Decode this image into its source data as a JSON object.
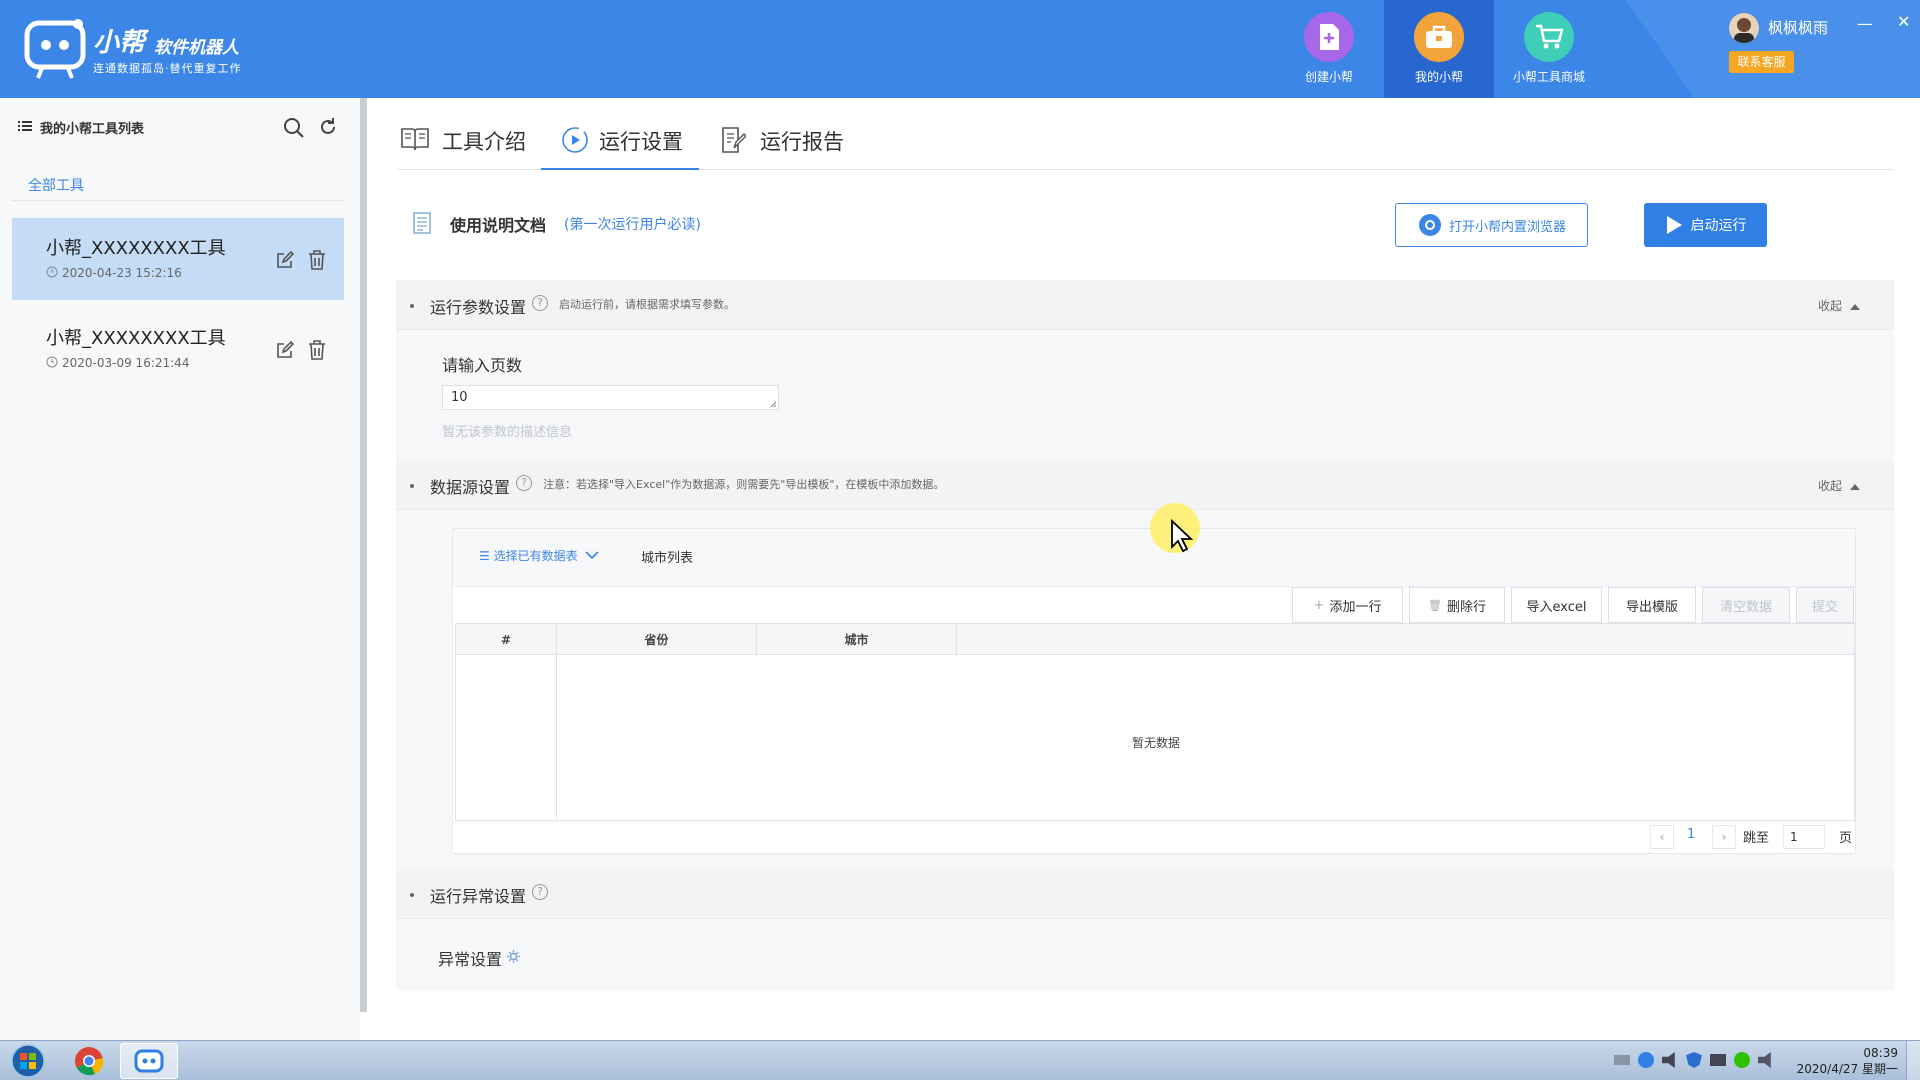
{
  "app": {
    "title": "小帮",
    "title_sub": "软件机器人",
    "slogan": "连通数据孤岛·替代重复工作"
  },
  "nav": [
    {
      "label": "创建小帮",
      "icon": "create-doc-icon",
      "color": "#a668e8"
    },
    {
      "label": "我的小帮",
      "icon": "toolbox-icon",
      "color": "#f2a33a"
    },
    {
      "label": "小帮工具商城",
      "icon": "cart-icon",
      "color": "#3fcfb8"
    }
  ],
  "user": {
    "name": "枫枫枫雨",
    "contact_label": "联系客服"
  },
  "window": {
    "minimize": "—",
    "close": "✕"
  },
  "sidebar": {
    "title": "我的小帮工具列表",
    "tab": "全部工具",
    "tools": [
      {
        "name": "小帮_XXXXXXXX工具",
        "date": "2020-04-23 15:2:16"
      },
      {
        "name": "小帮_XXXXXXXX工具",
        "date": "2020-03-09 16:21:44"
      }
    ]
  },
  "tabs": [
    "工具介绍",
    "运行设置",
    "运行报告"
  ],
  "doc": {
    "title": "使用说明文档",
    "note": "(第一次运行用户必读)",
    "browser_button": "打开小帮内置浏览器",
    "run_button": "启动运行"
  },
  "params": {
    "section_title": "运行参数设置",
    "section_desc": "启动运行前，请根据需求填写参数。",
    "collapse": "收起",
    "field_label": "请输入页数",
    "field_value": "10",
    "field_hint": "暂无该参数的描述信息"
  },
  "datasource": {
    "section_title": "数据源设置",
    "section_desc": "注意：若选择\"导入Excel\"作为数据源，则需要先\"导出模板\"，在模板中添加数据。",
    "collapse": "收起",
    "select_label": "选择已有数据表",
    "selected_table": "城市列表",
    "buttons": {
      "add_row": "添加一行",
      "delete_row": "删除行",
      "import_excel": "导入excel",
      "export_template": "导出模版",
      "clear_data": "清空数据",
      "submit": "提交"
    },
    "columns": [
      "#",
      "省份",
      "城市"
    ],
    "empty_text": "暂无数据",
    "pager": {
      "current": "1",
      "goto_label": "跳至",
      "goto_value": "1",
      "page_unit": "页"
    }
  },
  "exception": {
    "section_title": "运行异常设置",
    "label": "异常设置"
  },
  "taskbar": {
    "time": "08:39",
    "date": "2020/4/27 星期一"
  }
}
